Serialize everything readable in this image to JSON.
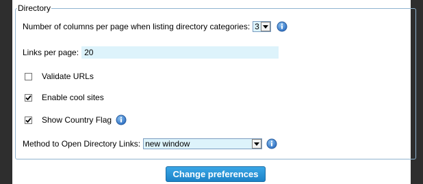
{
  "fieldset": {
    "legend": "Directory"
  },
  "columns": {
    "label": "Number of columns per page when listing directory categories:",
    "value": "3"
  },
  "links_per_page": {
    "label": "Links per page:",
    "value": "20"
  },
  "checkboxes": [
    {
      "label": "Validate URLs",
      "checked": false
    },
    {
      "label": "Enable cool sites",
      "checked": true
    },
    {
      "label": "Show Country Flag",
      "checked": true
    }
  ],
  "open_method": {
    "label": "Method to Open Directory Links:",
    "value": "new window"
  },
  "submit": {
    "label": "Change preferences"
  },
  "icons": {
    "info": "info-icon",
    "dropdown": "chevron-down-icon",
    "check": "checkmark-icon"
  },
  "colors": {
    "accent": "#1c83c8",
    "field_bg": "#ddf3fb",
    "border": "#8fb3cf",
    "backdrop": "#2e2e2e"
  }
}
